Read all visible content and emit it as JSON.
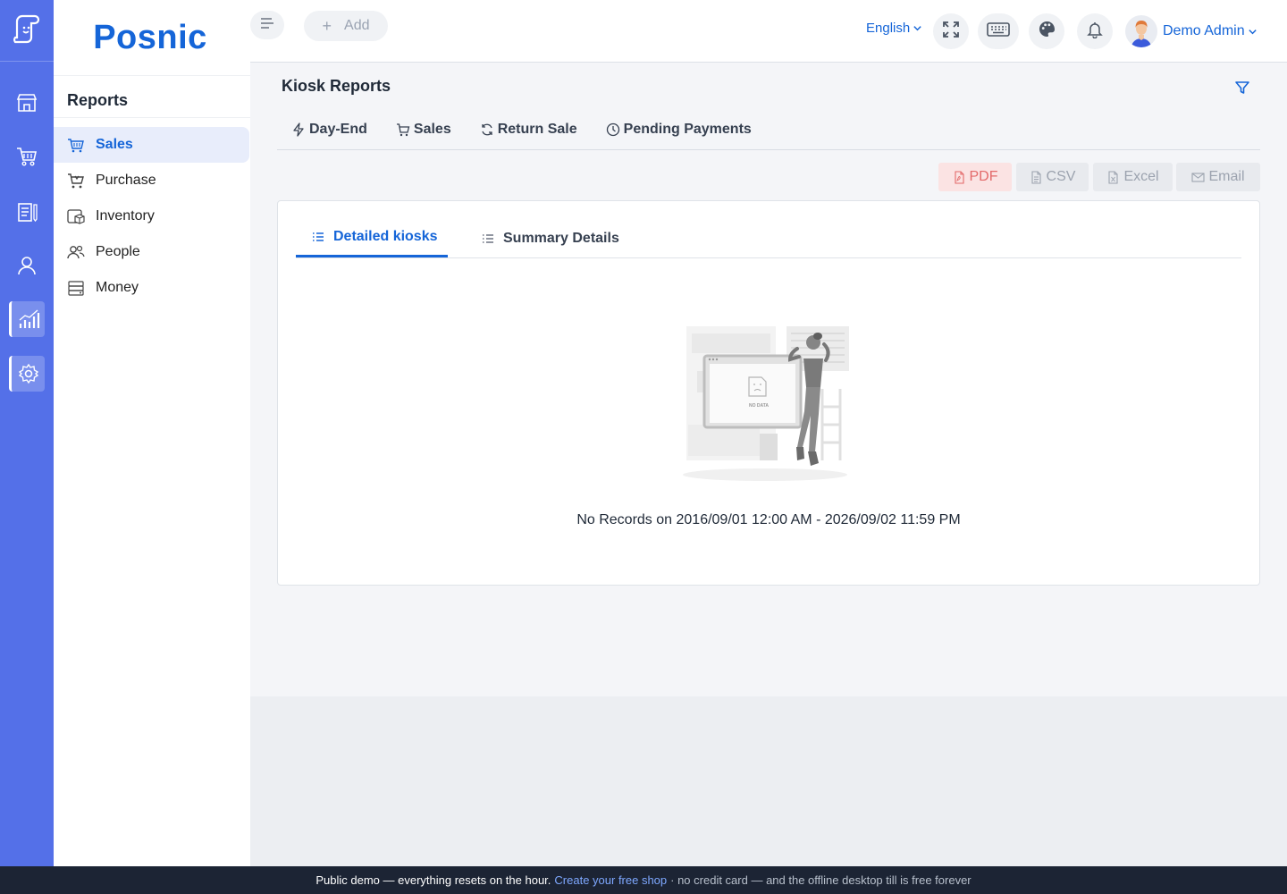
{
  "brand": {
    "name": "Posnic"
  },
  "rail": {
    "items": [
      {
        "name": "store-icon"
      },
      {
        "name": "cart-icon"
      },
      {
        "name": "clipboard-icon"
      },
      {
        "name": "user-icon"
      },
      {
        "name": "reports-chart-icon",
        "active": true
      },
      {
        "name": "settings-gear-icon"
      }
    ]
  },
  "submenu": {
    "title": "Reports",
    "items": [
      {
        "label": "Sales",
        "icon": "basket-icon",
        "active": true
      },
      {
        "label": "Purchase",
        "icon": "purchase-cart-icon"
      },
      {
        "label": "Inventory",
        "icon": "inventory-box-icon"
      },
      {
        "label": "People",
        "icon": "people-icon"
      },
      {
        "label": "Money",
        "icon": "money-stack-icon"
      }
    ]
  },
  "header": {
    "add_label": "Add",
    "language": "English",
    "user_name": "Demo Admin"
  },
  "page": {
    "title": "Kiosk Reports",
    "report_tabs": [
      {
        "label": "Day-End",
        "icon": "lightning-icon"
      },
      {
        "label": "Sales",
        "icon": "cart-icon"
      },
      {
        "label": "Return Sale",
        "icon": "refresh-icon"
      },
      {
        "label": "Pending Payments",
        "icon": "clock-icon"
      }
    ],
    "exports": {
      "pdf": "PDF",
      "csv": "CSV",
      "excel": "Excel",
      "email": "Email"
    },
    "card_tabs": [
      {
        "label": "Detailed kiosks",
        "active": true
      },
      {
        "label": "Summary Details",
        "active": false
      }
    ],
    "empty_illustration_text": "NO DATA",
    "empty_message": "No Records on 2016/09/01 12:00 AM - 2026/09/02 11:59 PM"
  },
  "footer": {
    "text": "Public demo — everything resets on the hour.",
    "link": "Create your free shop",
    "tail": "· no credit card — and the offline desktop till is free forever"
  },
  "colors": {
    "rail": "#5470e8",
    "accent": "#1565d8",
    "pdf": "#e05252",
    "footer": "#1c2434"
  }
}
